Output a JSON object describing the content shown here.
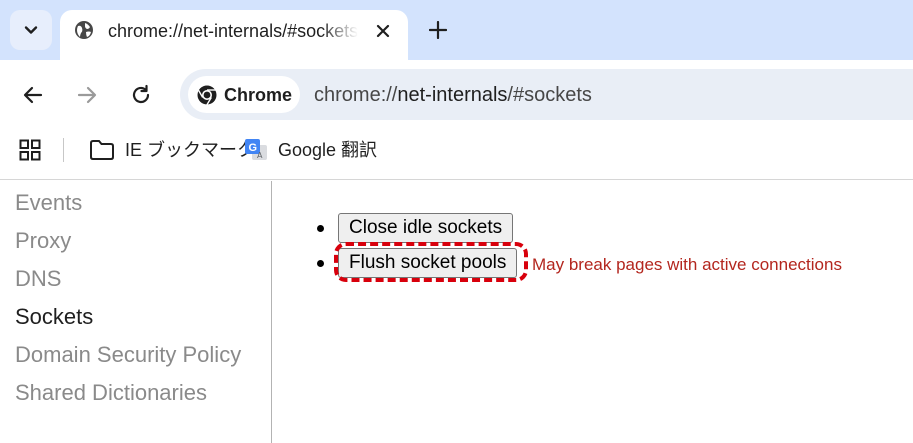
{
  "tab": {
    "title": "chrome://net-internals/#sockets",
    "favicon": "globe-icon"
  },
  "toolbar": {
    "chip_label": "Chrome",
    "url_scheme": "chrome://",
    "url_host": "net-internals",
    "url_path": "/#sockets"
  },
  "bookmarks": [
    {
      "label": "IE ブックマーク",
      "icon": "folder-icon"
    },
    {
      "label": "Google 翻訳",
      "icon": "google-translate-icon"
    }
  ],
  "sidebar": {
    "items": [
      {
        "label": "Events",
        "active": false
      },
      {
        "label": "Proxy",
        "active": false
      },
      {
        "label": "DNS",
        "active": false
      },
      {
        "label": "Sockets",
        "active": true
      },
      {
        "label": "Domain Security Policy",
        "active": false
      },
      {
        "label": "Shared Dictionaries",
        "active": false
      }
    ]
  },
  "main": {
    "close_idle_label": "Close idle sockets",
    "flush_pools_label": "Flush socket pools",
    "flush_warning": "May break pages with active connections"
  },
  "colors": {
    "tabstrip_bg": "#d3e3fd",
    "omnibox_bg": "#e9eef6",
    "warning_text": "#b3261e",
    "highlight": "#d8000c"
  }
}
